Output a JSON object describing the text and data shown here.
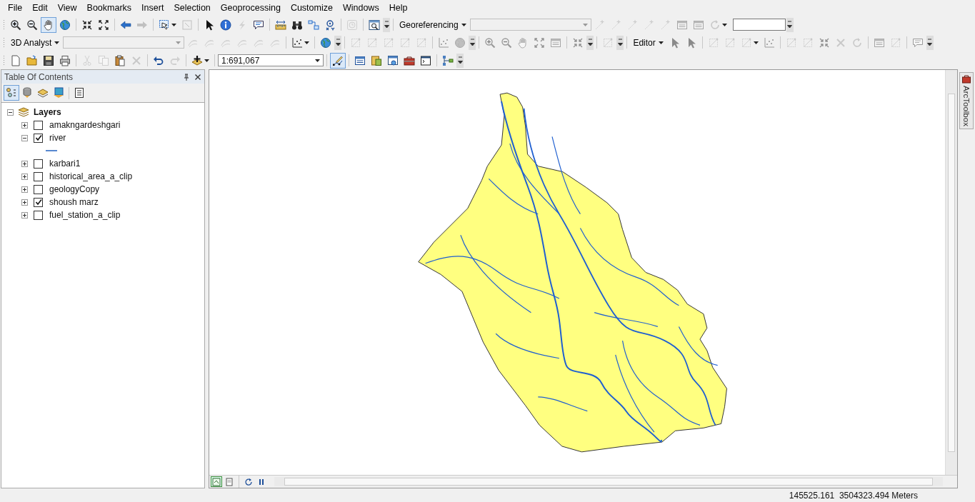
{
  "menu_bar": [
    "File",
    "Edit",
    "View",
    "Bookmarks",
    "Insert",
    "Selection",
    "Geoprocessing",
    "Customize",
    "Windows",
    "Help"
  ],
  "toolbars": [
    [
      [
        {
          "kind": "zoomin",
          "disabled": false,
          "selected": false
        },
        {
          "kind": "zoomout",
          "disabled": false,
          "selected": false
        },
        {
          "kind": "pan",
          "disabled": false,
          "selected": true
        },
        {
          "kind": "globe",
          "disabled": false,
          "selected": false
        }
      ],
      [
        {
          "kind": "fixedin",
          "disabled": false,
          "selected": false
        },
        {
          "kind": "fixedout",
          "disabled": false,
          "selected": false
        }
      ],
      [
        {
          "kind": "back",
          "disabled": false,
          "selected": false
        },
        {
          "kind": "forward",
          "disabled": true,
          "selected": false
        }
      ],
      [
        {
          "kind": "selectfeat",
          "disabled": false,
          "selected": false,
          "dropdown": true
        },
        {
          "kind": "clearsel",
          "disabled": true,
          "selected": false
        }
      ],
      [
        {
          "kind": "pointer",
          "disabled": false,
          "selected": false
        },
        {
          "kind": "identify",
          "disabled": false,
          "selected": false
        },
        {
          "kind": "hyperlink",
          "disabled": true,
          "selected": false
        },
        {
          "kind": "popup",
          "disabled": false,
          "selected": false
        }
      ],
      [
        {
          "kind": "measure",
          "disabled": false,
          "selected": false
        },
        {
          "kind": "find",
          "disabled": false,
          "selected": false
        },
        {
          "kind": "route",
          "disabled": false,
          "selected": false
        },
        {
          "kind": "gotoxy",
          "disabled": false,
          "selected": false
        }
      ],
      [
        {
          "kind": "timeslider",
          "disabled": true,
          "selected": false
        }
      ],
      [
        {
          "kind": "magnifier",
          "disabled": false,
          "selected": false
        },
        {
          "kind": "overflow"
        }
      ],
      [
        {
          "kind": "menu",
          "label": "Georeferencing"
        },
        {
          "kind": "combo",
          "disabled": true
        },
        {
          "kind": "addpoint",
          "disabled": true,
          "selected": false
        },
        {
          "kind": "addpoint",
          "disabled": true,
          "selected": false
        },
        {
          "kind": "addpoint",
          "disabled": true,
          "selected": false
        },
        {
          "kind": "addpoint",
          "disabled": true,
          "selected": false
        },
        {
          "kind": "addpoint",
          "disabled": true,
          "selected": false
        },
        {
          "kind": "table",
          "disabled": true,
          "selected": false
        },
        {
          "kind": "table",
          "disabled": true,
          "selected": false
        },
        {
          "kind": "rotate",
          "disabled": true,
          "selected": false,
          "dropdown": true
        },
        {
          "kind": "field"
        },
        {
          "kind": "overflow"
        }
      ]
    ],
    [
      [
        {
          "kind": "menu",
          "label": "3D Analyst"
        },
        {
          "kind": "combo",
          "disabled": true
        },
        {
          "kind": "contour",
          "disabled": true,
          "selected": false
        },
        {
          "kind": "contour",
          "disabled": true,
          "selected": false
        },
        {
          "kind": "contour",
          "disabled": true,
          "selected": false
        },
        {
          "kind": "contour",
          "disabled": true,
          "selected": false
        },
        {
          "kind": "contour",
          "disabled": true,
          "selected": false
        },
        {
          "kind": "contour",
          "disabled": true,
          "selected": false
        }
      ],
      [
        {
          "kind": "scatter",
          "disabled": false,
          "selected": false,
          "dropdown": true
        }
      ],
      [
        {
          "kind": "globe",
          "disabled": false,
          "selected": false
        },
        {
          "kind": "overflow"
        }
      ],
      [
        {
          "kind": "edit",
          "disabled": true,
          "selected": false
        },
        {
          "kind": "edit",
          "disabled": true,
          "selected": false
        },
        {
          "kind": "edit",
          "disabled": true,
          "selected": false
        },
        {
          "kind": "edit",
          "disabled": true,
          "selected": false
        },
        {
          "kind": "edit",
          "disabled": true,
          "selected": false
        }
      ],
      [
        {
          "kind": "scatter",
          "disabled": true,
          "selected": false
        },
        {
          "kind": "globe",
          "disabled": true,
          "selected": false
        },
        {
          "kind": "overflow"
        }
      ],
      [
        {
          "kind": "zoomin",
          "disabled": true,
          "selected": false
        },
        {
          "kind": "zoomout",
          "disabled": true,
          "selected": false
        },
        {
          "kind": "pan",
          "disabled": true,
          "selected": false
        },
        {
          "kind": "fixedout",
          "disabled": true,
          "selected": false
        },
        {
          "kind": "table",
          "disabled": true,
          "selected": false
        }
      ],
      [
        {
          "kind": "fixedin",
          "disabled": true,
          "selected": false
        },
        {
          "kind": "overflow"
        }
      ],
      [
        {
          "kind": "edit",
          "disabled": true,
          "selected": false
        },
        {
          "kind": "overflow"
        }
      ],
      [
        {
          "kind": "menu",
          "label": "Editor"
        },
        {
          "kind": "pointer",
          "disabled": true,
          "selected": false
        },
        {
          "kind": "pointer",
          "disabled": true,
          "selected": false
        }
      ],
      [
        {
          "kind": "edit",
          "disabled": true,
          "selected": false
        },
        {
          "kind": "edit",
          "disabled": true,
          "selected": false
        },
        {
          "kind": "edit",
          "disabled": true,
          "selected": false,
          "dropdown": true
        },
        {
          "kind": "scatter",
          "disabled": true,
          "selected": false
        }
      ],
      [
        {
          "kind": "edit",
          "disabled": true,
          "selected": false
        },
        {
          "kind": "edit",
          "disabled": true,
          "selected": false
        },
        {
          "kind": "fixedin",
          "disabled": true,
          "selected": false
        },
        {
          "kind": "delete",
          "disabled": true,
          "selected": false
        },
        {
          "kind": "rotate",
          "disabled": true,
          "selected": false
        }
      ],
      [
        {
          "kind": "table",
          "disabled": true,
          "selected": false
        },
        {
          "kind": "edit",
          "disabled": true,
          "selected": false
        }
      ],
      [
        {
          "kind": "popup",
          "disabled": true,
          "selected": false
        },
        {
          "kind": "overflow"
        }
      ]
    ],
    [
      [
        {
          "kind": "new",
          "disabled": false,
          "selected": false
        },
        {
          "kind": "open",
          "disabled": false,
          "selected": false
        },
        {
          "kind": "save",
          "disabled": false,
          "selected": false
        },
        {
          "kind": "print",
          "disabled": false,
          "selected": false
        }
      ],
      [
        {
          "kind": "cut",
          "disabled": true,
          "selected": false
        },
        {
          "kind": "copy",
          "disabled": true,
          "selected": false
        },
        {
          "kind": "paste",
          "disabled": false,
          "selected": false
        },
        {
          "kind": "delete",
          "disabled": true,
          "selected": false
        }
      ],
      [
        {
          "kind": "undo",
          "disabled": false,
          "selected": false
        },
        {
          "kind": "redo",
          "disabled": true,
          "selected": false
        }
      ],
      [
        {
          "kind": "adddata",
          "disabled": false,
          "selected": false,
          "dropdown": true
        }
      ],
      [
        {
          "kind": "combo",
          "disabled": false,
          "value": "1:691,067"
        }
      ],
      [
        {
          "kind": "editor",
          "disabled": false,
          "selected": true
        }
      ],
      [
        {
          "kind": "table",
          "disabled": false,
          "selected": false
        },
        {
          "kind": "catalog",
          "disabled": false,
          "selected": false
        },
        {
          "kind": "search",
          "disabled": false,
          "selected": false
        },
        {
          "kind": "toolbox",
          "disabled": false,
          "selected": false
        },
        {
          "kind": "python",
          "disabled": false,
          "selected": false
        }
      ],
      [
        {
          "kind": "model",
          "disabled": false,
          "selected": false
        },
        {
          "kind": "overflow"
        }
      ]
    ]
  ],
  "toc": {
    "title": "Table Of Contents",
    "views": [
      {
        "kind": "drawing-order",
        "selected": true
      },
      {
        "kind": "source",
        "selected": false
      },
      {
        "kind": "visibility",
        "selected": false
      },
      {
        "kind": "selection",
        "selected": false
      },
      {
        "kind": "options",
        "selected": false
      }
    ],
    "root": {
      "label": "Layers",
      "expanded": true,
      "children": [
        {
          "label": "amakngardeshgari",
          "checked": false,
          "expanded": false
        },
        {
          "label": "river",
          "checked": true,
          "expanded": true
        },
        {
          "label": "karbari1",
          "checked": false,
          "expanded": false
        },
        {
          "label": "historical_area_a_clip",
          "checked": false,
          "expanded": false
        },
        {
          "label": "geologyCopy",
          "checked": false,
          "expanded": false
        },
        {
          "label": "shoush marz",
          "checked": true,
          "expanded": false
        },
        {
          "label": "fuel_station_a_clip",
          "checked": false,
          "expanded": false
        }
      ]
    }
  },
  "map_controls": [
    {
      "kind": "data-view",
      "selected": true
    },
    {
      "kind": "layout-view",
      "selected": false
    },
    {
      "kind": "refresh",
      "selected": false
    },
    {
      "kind": "pause",
      "selected": false
    }
  ],
  "dock_tab": {
    "label": "ArcToolbox"
  },
  "status_bar": {
    "coordinates": "145525.161  3504323.494 Meters"
  }
}
